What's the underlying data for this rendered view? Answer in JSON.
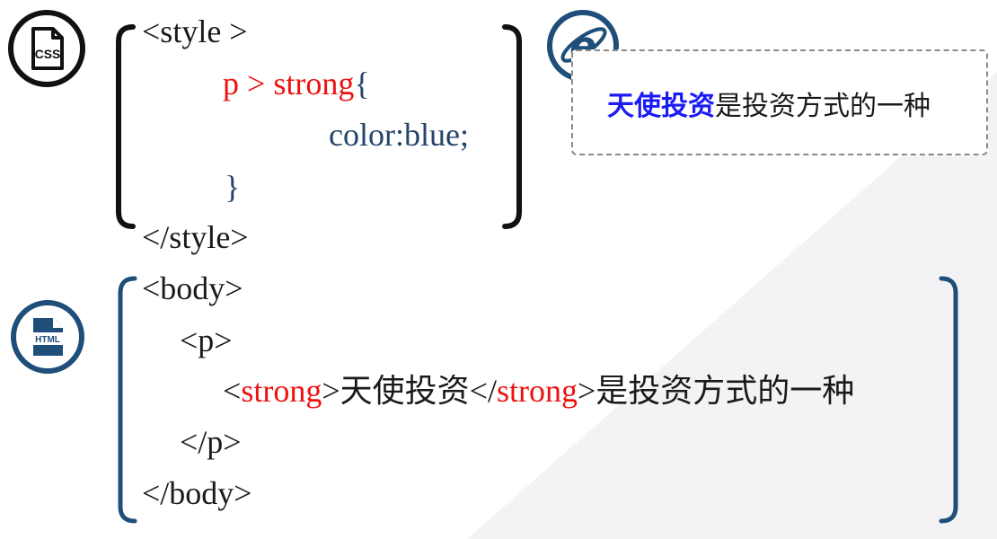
{
  "css_code": {
    "style_open": "<style >",
    "selector_p": "p",
    "selector_gt": ">",
    "selector_strong": "strong",
    "brace_open": "{",
    "declaration": "color:blue;",
    "brace_close": "}",
    "style_close": "</style>"
  },
  "html_code": {
    "body_open": "<body>",
    "p_open": "<p>",
    "lt1": "<",
    "strong_open_tag": "strong",
    "gt1": ">",
    "strong_text": "天使投资",
    "lt2": "</",
    "strong_close_tag": "strong",
    "gt2": ">",
    "rest_text": "是投资方式的一种",
    "p_close": "</p>",
    "body_close": "</body>"
  },
  "preview": {
    "strong_text": "天使投资",
    "rest_text": "是投资方式的一种"
  },
  "icons": {
    "css_file": "css-file-icon",
    "html_file": "html-file-icon",
    "browser": "ie-browser-icon",
    "css_badge_text": "CSS",
    "html_badge_text": "HTML"
  },
  "colors": {
    "code_black": "#1a1a1a",
    "code_red": "#ee1111",
    "code_navy": "#23456b",
    "preview_blue": "#1a1af5",
    "icon_navy": "#1f4e79"
  }
}
